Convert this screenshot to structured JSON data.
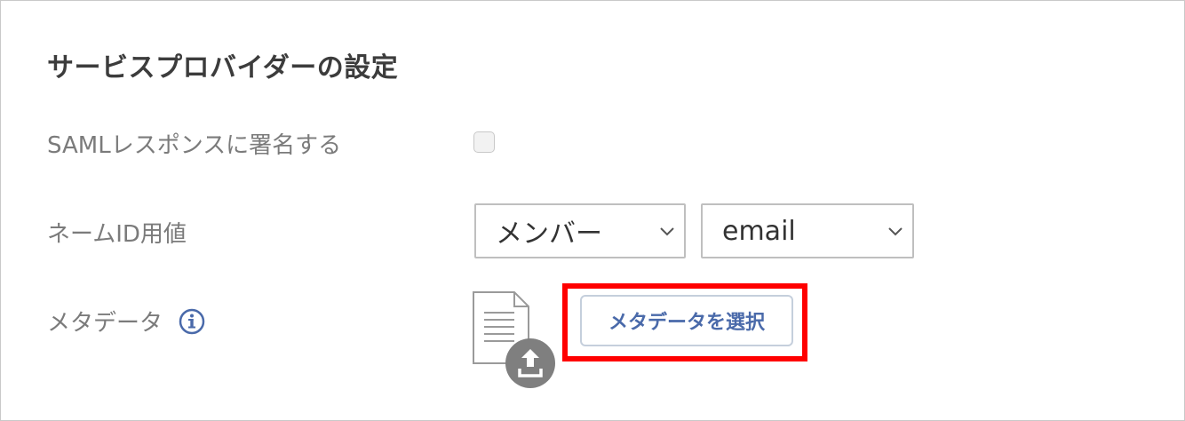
{
  "section": {
    "title": "サービスプロバイダーの設定"
  },
  "saml_response": {
    "label": "SAMLレスポンスに署名する",
    "checked": false
  },
  "name_id": {
    "label": "ネームID用値",
    "member_select": {
      "value": "メンバー"
    },
    "attribute_select": {
      "value": "email"
    }
  },
  "metadata": {
    "label": "メタデータ",
    "info_icon": "info-icon",
    "file_icon": "document-upload-icon",
    "button_label": "メタデータを選択"
  },
  "colors": {
    "highlight": "#ff0000",
    "button_text": "#4a6aaa",
    "info_icon": "#4a6aaa"
  }
}
